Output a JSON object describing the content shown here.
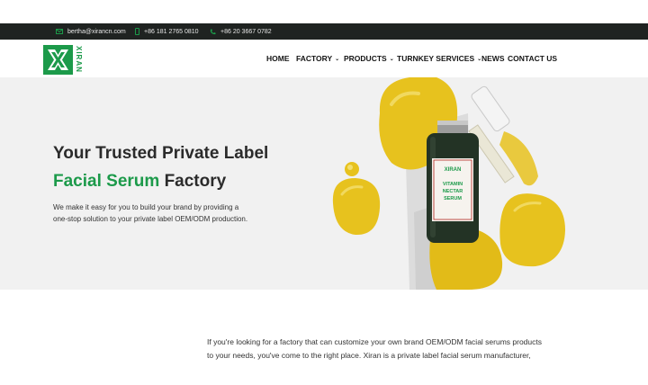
{
  "topbar": {
    "email": "bertha@xirancn.com",
    "mobile": "+86 181 2765 0810",
    "phone": "+86 20 3667 0782"
  },
  "header": {
    "logo_text": "XIRAN",
    "nav": [
      {
        "label": "HOME"
      },
      {
        "label": "FACTORY"
      },
      {
        "label": "PRODUCTS"
      },
      {
        "label": "TURNKEY SERVICES"
      },
      {
        "label": "NEWS"
      },
      {
        "label": "CONTACT US"
      }
    ]
  },
  "hero": {
    "title_line1": "Your Trusted Private Label",
    "title_line2_green": "Facial Serum",
    "title_line2_rest": "Factory",
    "description": "We make it easy for you to build your brand by providing a one-stop solution to your private label OEM/ODM production.",
    "bottle_brand": "XIRAN",
    "bottle_label": "VITAMIN NECTAR SERUM"
  },
  "content": {
    "paragraph": "If you're looking for a factory that can customize your own brand OEM/ODM facial serums products to your needs, you've come to the right place. Xiran is a private label facial serum manufacturer,"
  },
  "colors": {
    "brand_green": "#1c9a4a",
    "topbar_bg": "#1f2321",
    "hero_bg": "#f1f1f1",
    "serum_yellow": "#e7c21e"
  }
}
